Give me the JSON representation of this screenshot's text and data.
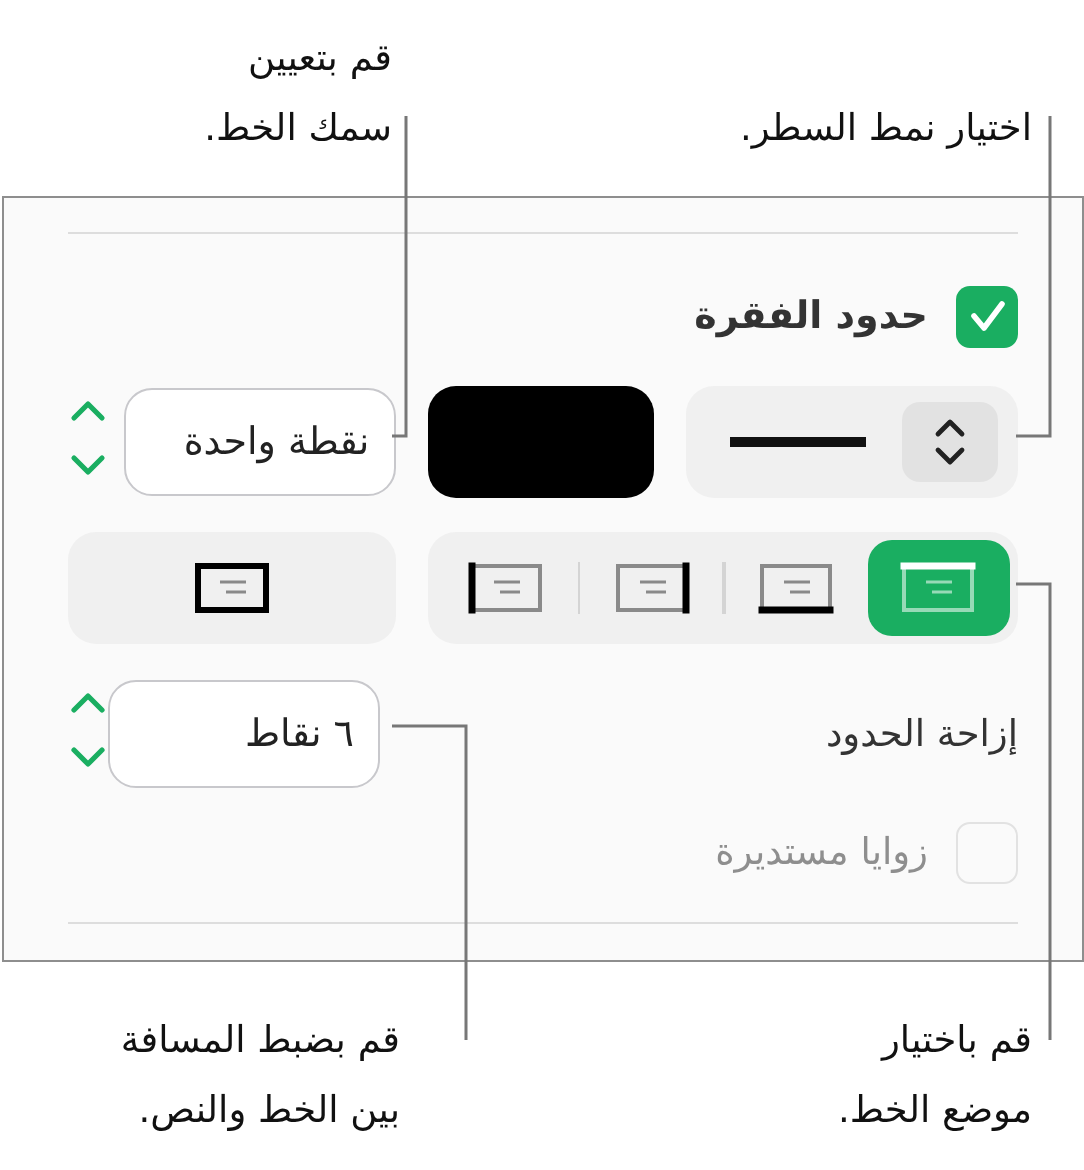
{
  "callouts_top": [
    {
      "text": "اختيار نمط السطر."
    },
    {
      "text": "قم بتعيين\nسمك الخط."
    }
  ],
  "panel": {
    "border_checkbox": {
      "label": "حدود الفقرة",
      "checked": true
    },
    "line_style": {
      "kind": "solid"
    },
    "color_well": {
      "color": "#000000"
    },
    "width_field": {
      "value": "نقطة واحدة"
    },
    "position_buttons": [
      {
        "kind": "top",
        "selected": true
      },
      {
        "kind": "bottom",
        "selected": false
      },
      {
        "kind": "right",
        "selected": false
      },
      {
        "kind": "left",
        "selected": false
      }
    ],
    "box_button": {
      "kind": "box",
      "selected": false
    },
    "offset": {
      "label": "إزاحة الحدود",
      "value": "٦ نقاط"
    },
    "rounded_corners": {
      "label": "زوايا مستديرة",
      "checked": false,
      "disabled": true
    }
  },
  "callouts_bottom": [
    {
      "text": "قم باختيار\nموضع الخط."
    },
    {
      "text": "قم بضبط المسافة\nبين الخط والنص."
    }
  ]
}
